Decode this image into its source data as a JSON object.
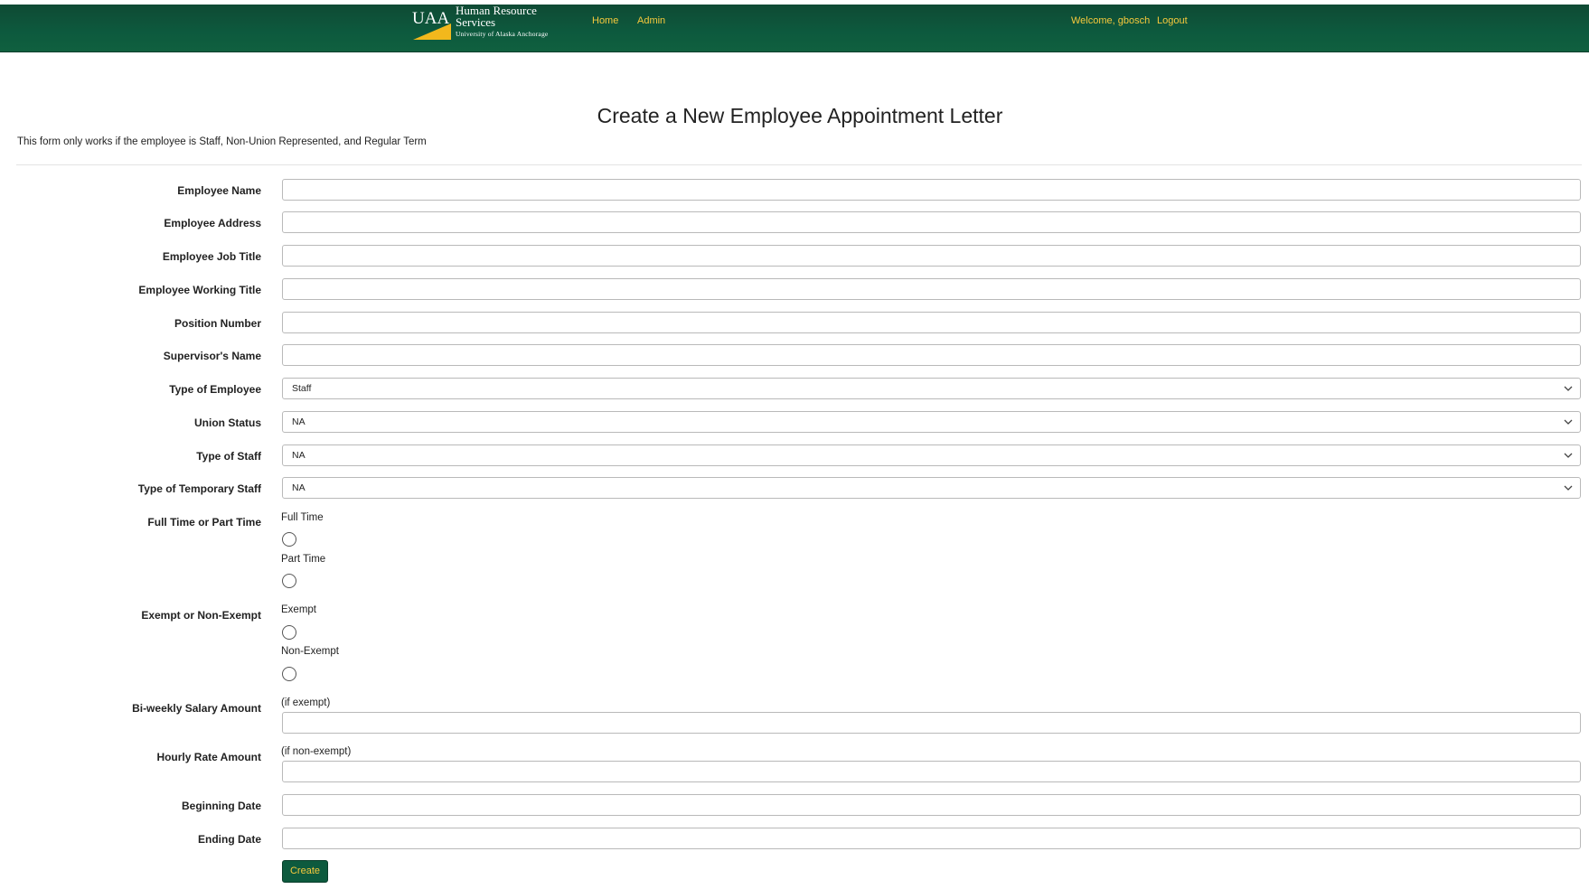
{
  "header": {
    "brand_mark": "UAA",
    "brand_line1": "Human Resource",
    "brand_line2": "Services",
    "brand_line3": "University of Alaska Anchorage",
    "nav": {
      "home": "Home",
      "admin": "Admin"
    },
    "welcome": "Welcome, gbosch",
    "logout": "Logout",
    "colors": {
      "bar": "#0d5a3e",
      "link": "#f7c93c",
      "brand_gold": "#f2b81c"
    }
  },
  "page": {
    "title": "Create a New Employee Appointment Letter",
    "notice": "This form only works if the employee is Staff, Non-Union Represented, and Regular Term"
  },
  "form": {
    "employee_name": {
      "label": "Employee Name",
      "value": ""
    },
    "employee_address": {
      "label": "Employee Address",
      "value": ""
    },
    "employee_job_title": {
      "label": "Employee Job Title",
      "value": ""
    },
    "employee_working_title": {
      "label": "Employee Working Title",
      "value": ""
    },
    "position_number": {
      "label": "Position Number",
      "value": ""
    },
    "supervisor_name": {
      "label": "Supervisor's Name",
      "value": ""
    },
    "type_of_employee": {
      "label": "Type of Employee",
      "selected": "Staff"
    },
    "union_status": {
      "label": "Union Status",
      "selected": "NA"
    },
    "type_of_staff": {
      "label": "Type of Staff",
      "selected": "NA"
    },
    "type_of_temporary_staff": {
      "label": "Type of Temporary Staff",
      "selected": "NA"
    },
    "full_or_part_time": {
      "label": "Full Time or Part Time",
      "options": [
        "Full Time",
        "Part Time"
      ],
      "selected": null
    },
    "exempt_status": {
      "label": "Exempt or Non-Exempt",
      "options": [
        "Exempt",
        "Non-Exempt"
      ],
      "selected": null
    },
    "biweekly_salary": {
      "label": "Bi-weekly Salary Amount",
      "hint": "(if exempt)",
      "value": ""
    },
    "hourly_rate": {
      "label": "Hourly Rate Amount",
      "hint": "(if non-exempt)",
      "value": ""
    },
    "beginning_date": {
      "label": "Beginning Date",
      "value": ""
    },
    "ending_date": {
      "label": "Ending Date",
      "value": ""
    },
    "submit_label": "Create"
  }
}
